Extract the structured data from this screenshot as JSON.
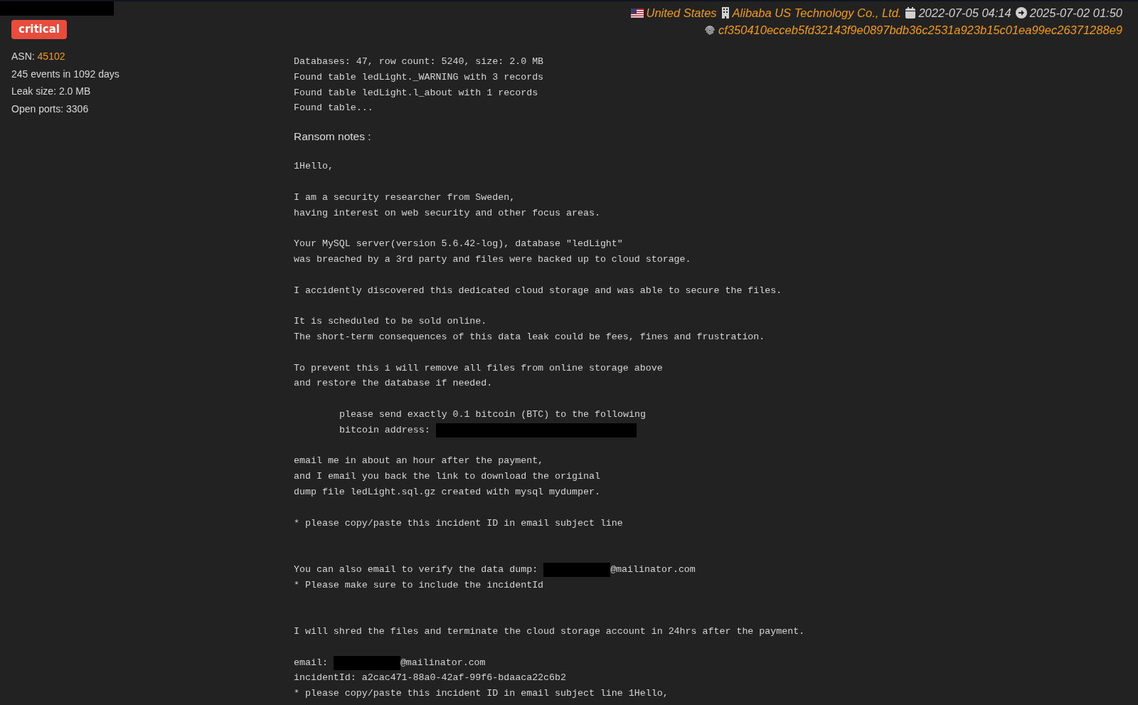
{
  "severity": {
    "label": "critical"
  },
  "stats": [
    {
      "label": "ASN: ",
      "value": "45102"
    },
    {
      "label": "245 events in 1092 days"
    },
    {
      "label": "Leak size: 2.0 MB"
    },
    {
      "label": "Open ports: 3306"
    }
  ],
  "meta": {
    "country": "United States",
    "organization": "Alibaba US Technology Co., Ltd.",
    "first_seen": "2022-07-05 04:14",
    "last_seen": "2025-07-02 01:50",
    "hash": "cf350410ecceb5fd32143f9e0897bdb36c2531a923b15c01ea99ec26371288e9"
  },
  "summary": [
    "Databases: 47, row count: 5240, size: 2.0 MB",
    "Found table ledLight._WARNING with 3 records",
    "Found table ledLight.l_about with 1 records",
    "Found table..."
  ],
  "notes_title": "Ransom notes :",
  "notes": [
    {
      "kind": "text",
      "text": "1Hello,"
    },
    {
      "kind": "blank"
    },
    {
      "kind": "text",
      "text": "I am a security researcher from Sweden,"
    },
    {
      "kind": "text",
      "text": "having interest on web security and other focus areas."
    },
    {
      "kind": "blank"
    },
    {
      "kind": "text",
      "text": "Your MySQL server(version 5.6.42-log), database \"ledLight\""
    },
    {
      "kind": "text",
      "text": "was breached by a 3rd party and files were backed up to cloud storage."
    },
    {
      "kind": "blank"
    },
    {
      "kind": "text",
      "text": "I accidently discovered this dedicated cloud storage and was able to secure the files."
    },
    {
      "kind": "blank"
    },
    {
      "kind": "text",
      "text": "It is scheduled to be sold online."
    },
    {
      "kind": "text",
      "text": "The short-term consequences of this data leak could be fees, fines and frustration."
    },
    {
      "kind": "blank"
    },
    {
      "kind": "text",
      "text": "To prevent this i will remove all files from online storage above"
    },
    {
      "kind": "text",
      "text": "and restore the database if needed."
    },
    {
      "kind": "blank"
    },
    {
      "kind": "indented",
      "text": "please send exactly 0.1 bitcoin (BTC) to the following"
    },
    {
      "kind": "indented",
      "before": "bitcoin address:",
      "redacted": true
    },
    {
      "kind": "blank"
    },
    {
      "kind": "text",
      "text": "email me in about an hour after the payment,"
    },
    {
      "kind": "text",
      "text": "and I email you back the link to download the original"
    },
    {
      "kind": "text",
      "text": "dump file ledLight.sql.gz created with mysql mydumper."
    },
    {
      "kind": "blank"
    },
    {
      "kind": "text",
      "text": "* please copy/paste this incident ID in email subject line"
    },
    {
      "kind": "blank"
    },
    {
      "kind": "blank"
    },
    {
      "kind": "text",
      "before": "You can also email to verify the data dump:",
      "redacted": true,
      "after": "@mailinator.com"
    },
    {
      "kind": "text",
      "text": "* Please make sure to include the incidentId"
    },
    {
      "kind": "blank"
    },
    {
      "kind": "blank"
    },
    {
      "kind": "text",
      "text": "I will shred the files and terminate the cloud storage account in 24hrs after the payment."
    },
    {
      "kind": "blank"
    },
    {
      "kind": "text",
      "before": "email:",
      "redacted": true,
      "after": "@mailinator.com"
    },
    {
      "kind": "text",
      "text": "incidentId: a2cac471-88a0-42af-99f6-bdaaca22c6b2"
    },
    {
      "kind": "text",
      "text": "* please copy/paste this incident ID in email subject line 1Hello,"
    }
  ]
}
